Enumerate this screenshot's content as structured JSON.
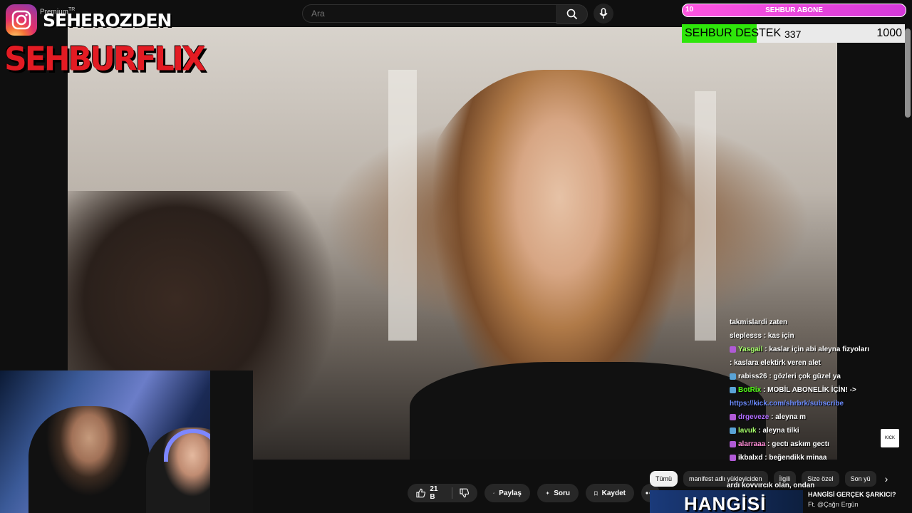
{
  "search": {
    "placeholder": "Ara"
  },
  "overlay": {
    "brand_name": "SEHEROZDEN",
    "premium_label": "Premium",
    "premium_region": "TR",
    "channel_logo_text": "SEHBURFLIX"
  },
  "subscriber_goal": {
    "count": "10",
    "label": "SEHBUR ABONE"
  },
  "donation_goal": {
    "label": "SEHBUR DESTEK",
    "current": "337",
    "goal": "1000",
    "progress_fraction": 0.337
  },
  "chat": {
    "messages": [
      {
        "user": "",
        "text": "takmislardi zaten",
        "color": "#ffffff",
        "badge_color": ""
      },
      {
        "user": "sleplesss",
        "text": ": kas için",
        "color": "#ffffff",
        "badge_color": ""
      },
      {
        "user": "Yasgail",
        "text": ": kaslar için abi aleyna fizyoları",
        "color": "#a7ff6b",
        "badge_color": "#b05ad6"
      },
      {
        "user": "",
        "text": ": kaslara elektirk veren alet",
        "color": "#ffffff",
        "badge_color": ""
      },
      {
        "user": "rabiss26",
        "text": ": gözleri çok güzel ya",
        "color": "#ffffff",
        "badge_color": "#5aa3d6"
      },
      {
        "user": "BotRix",
        "text": ": MOBİL ABONELİK İÇİN! ->",
        "color": "#53fc18",
        "badge_color": "#5aa3d6"
      },
      {
        "user": "",
        "text": "",
        "link": "https://kick.com/shrbrk/subscribe",
        "color": "#6c8cff",
        "badge_color": ""
      },
      {
        "user": "drgeveze",
        "text": ": aleyna m",
        "color": "#b06cff",
        "badge_color": "#b05ad6"
      },
      {
        "user": "lavuk",
        "text": ": aleyna tilki",
        "color": "#a7ff6b",
        "badge_color": "#5aa3d6"
      },
      {
        "user": "alarraaa",
        "text": ": gectı askım gectı",
        "color": "#ff8cd6",
        "badge_color": "#b05ad6"
      },
      {
        "user": "ikbalxd",
        "text": ": beğendikk minaa",
        "color": "#ffffff",
        "badge_color": "#b05ad6"
      }
    ]
  },
  "actions": {
    "like": "21 B",
    "share": "Paylaş",
    "ask": "Soru",
    "save": "Kaydet"
  },
  "chips": [
    "Tümü",
    "manifest adlı yükleyiciden",
    "İlgili",
    "Size özel",
    "Son yü"
  ],
  "description_fragment": "ardı kovvırcık olan, ondan",
  "recommendation": {
    "thumbnail_text": "HANGİSİ",
    "title": "HANGİSİ GERÇEK ŞARKICI?",
    "channel": "Ft. @Çağrı Ergün"
  },
  "kick_logo_text": "KICK"
}
